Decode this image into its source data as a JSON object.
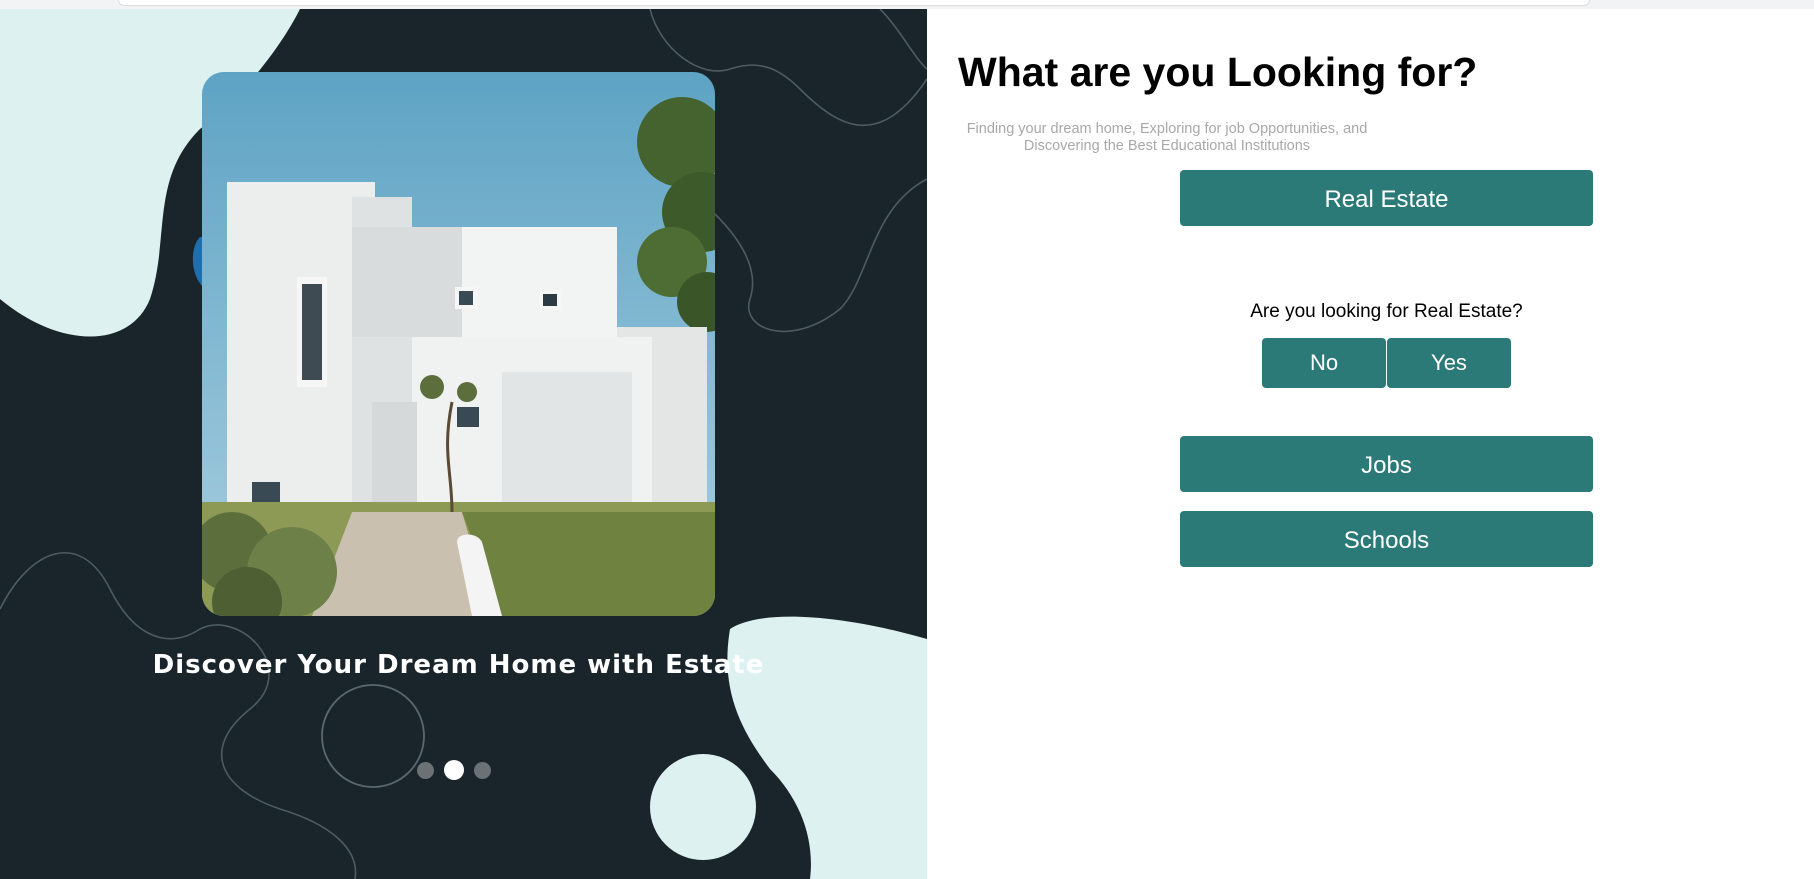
{
  "hero": {
    "image_alt": "modern white house",
    "caption": "Discover Your Dream Home with Estate",
    "carousel": {
      "slide_count": 3,
      "active_index": 1
    }
  },
  "panel": {
    "title": "What are you Looking for?",
    "subtitle": "Finding your dream home, Exploring for job Opportunities, and Discovering the Best Educational Institutions",
    "categories": {
      "real_estate": "Real Estate",
      "jobs": "Jobs",
      "schools": "Schools"
    },
    "question": "Are you looking for Real Estate?",
    "answers": {
      "no": "No",
      "yes": "Yes"
    }
  },
  "colors": {
    "accent": "#2c7a77",
    "hero_dark": "#1a252b",
    "hero_light": "#dcf1f0"
  }
}
